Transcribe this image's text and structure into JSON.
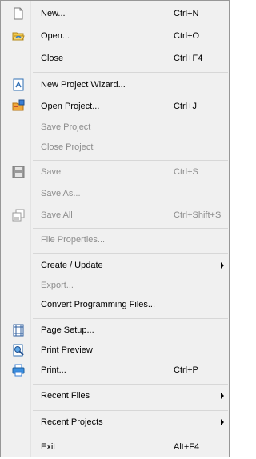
{
  "menu": {
    "items": {
      "new": {
        "label": "New...",
        "shortcut": "Ctrl+N"
      },
      "open": {
        "label": "Open...",
        "shortcut": "Ctrl+O"
      },
      "close": {
        "label": "Close",
        "shortcut": "Ctrl+F4"
      },
      "new_project_wizard": {
        "label": "New Project Wizard..."
      },
      "open_project": {
        "label": "Open Project...",
        "shortcut": "Ctrl+J"
      },
      "save_project": {
        "label": "Save Project"
      },
      "close_project": {
        "label": "Close Project"
      },
      "save": {
        "label": "Save",
        "shortcut": "Ctrl+S"
      },
      "save_as": {
        "label": "Save As..."
      },
      "save_all": {
        "label": "Save All",
        "shortcut": "Ctrl+Shift+S"
      },
      "file_properties": {
        "label": "File Properties..."
      },
      "create_update": {
        "label": "Create / Update"
      },
      "export": {
        "label": "Export..."
      },
      "convert_programming_files": {
        "label": "Convert Programming Files..."
      },
      "page_setup": {
        "label": "Page Setup..."
      },
      "print_preview": {
        "label": "Print Preview"
      },
      "print": {
        "label": "Print...",
        "shortcut": "Ctrl+P"
      },
      "recent_files": {
        "label": "Recent Files"
      },
      "recent_projects": {
        "label": "Recent Projects"
      },
      "exit": {
        "label": "Exit",
        "shortcut": "Alt+F4"
      }
    }
  }
}
